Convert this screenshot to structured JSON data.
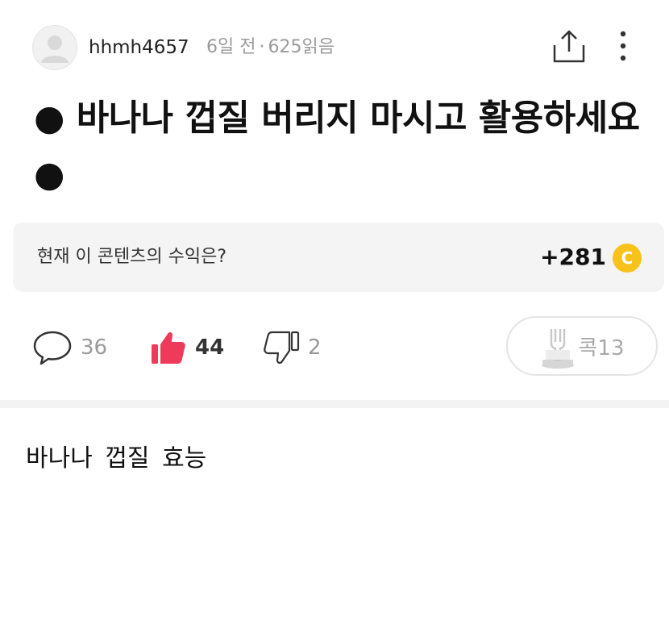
{
  "author": {
    "username": "hhmh4657",
    "time_ago": "6일 전",
    "separator": "·",
    "views": "625읽음"
  },
  "post": {
    "title": "● 바나나 껍질 버리지 마시고 활용하세요 ●",
    "body": "바나나 껍질 효능"
  },
  "revenue": {
    "label": "현재 이 콘텐츠의 수익은?",
    "amount": "+281",
    "coin_symbol": "C",
    "coin_color": "#f8c21c"
  },
  "reactions": {
    "comments": "36",
    "likes": "44",
    "dislikes": "2",
    "kok_label": "콕",
    "kok_count": "13",
    "like_color": "#ee3b5c"
  },
  "icons": {
    "avatar": "default-user-avatar",
    "share": "share-upload-icon",
    "more": "vertical-dots-icon",
    "comment": "speech-bubble-icon",
    "like": "thumbs-up-icon",
    "dislike": "thumbs-down-icon",
    "kok": "fork-cake-icon"
  }
}
